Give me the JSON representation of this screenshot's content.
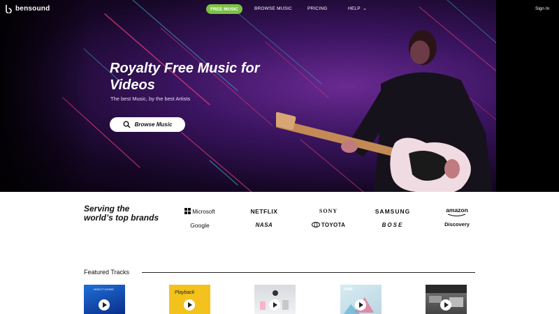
{
  "nav": {
    "logo": "bensound",
    "free_music": "FREE MUSIC",
    "browse_music": "BROWSE MUSIC",
    "pricing": "PRICING",
    "help": "HELP",
    "sign_in": "Sign In"
  },
  "hero": {
    "title": "Royalty Free Music for Videos",
    "subtitle": "The best Music, by the best Artists",
    "button": "Browse Music"
  },
  "brands": {
    "title": "Serving the world’s top brands",
    "logos": [
      "Microsoft",
      "NETFLIX",
      "SONY",
      "SAMSUNG",
      "amazon",
      "Google",
      "NASA",
      "TOYOTA",
      "BOSE",
      "Discovery"
    ]
  },
  "featured": {
    "title": "Featured Tracks",
    "tracks": [
      {
        "thumb_text": "HOW IT GOING"
      },
      {
        "thumb_text": "Playback"
      },
      {
        "thumb_text": ""
      },
      {
        "thumb_text": "YANA"
      },
      {
        "thumb_text": ""
      }
    ]
  },
  "colors": {
    "accent_green": "#7ac142",
    "hero_purple": "#3a1460"
  }
}
